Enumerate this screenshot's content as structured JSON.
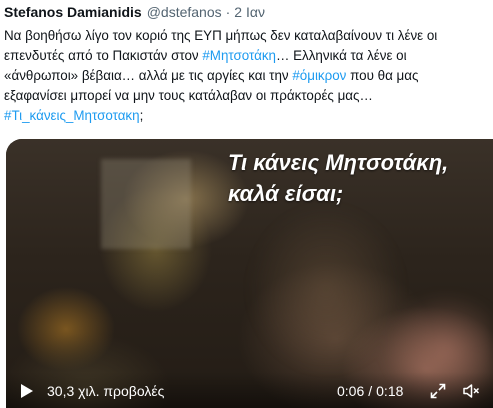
{
  "tweet": {
    "author_name": "Stefanos Damianidis",
    "handle": "@dstefanos",
    "separator": "·",
    "time": "2 Ιαν",
    "text": {
      "line1": "Να βοηθήσω λίγο τον κοριό της ΕΥΠ μήπως δεν καταλαβαίνουν τι λένε οι",
      "line2_before": "επενδυτές από το Πακιστάν στον ",
      "line2_hashtag": "#Μητσοτάκη",
      "line2_after": "… Ελληνικά τα λένε οι",
      "line3_before": "«άνθρωποι» βέβαια… αλλά με τις αργίες και την ",
      "line3_hashtag": "#όμικρον",
      "line3_after": " που θα μας",
      "line4": "εξαφανίσει μπορεί να μην τους κατάλαβαν οι πράκτορές μας…",
      "line5_hashtag": "#Τι_κάνεις_Μητσοτακη",
      "line5_after": ";"
    }
  },
  "video": {
    "overlay_line1": "Τι κάνεις Μητσοτάκη,",
    "overlay_line2": "καλά είσαι;",
    "views": "30,3 χιλ. προβολές",
    "current_time": "0:06",
    "time_separator": "/",
    "duration": "0:18",
    "icons": {
      "play": "play-icon",
      "fullscreen": "fullscreen-icon",
      "mute": "speaker-muted-icon"
    }
  },
  "colors": {
    "link": "#1d9bf0",
    "text": "#0f1419",
    "secondary": "#536471"
  }
}
